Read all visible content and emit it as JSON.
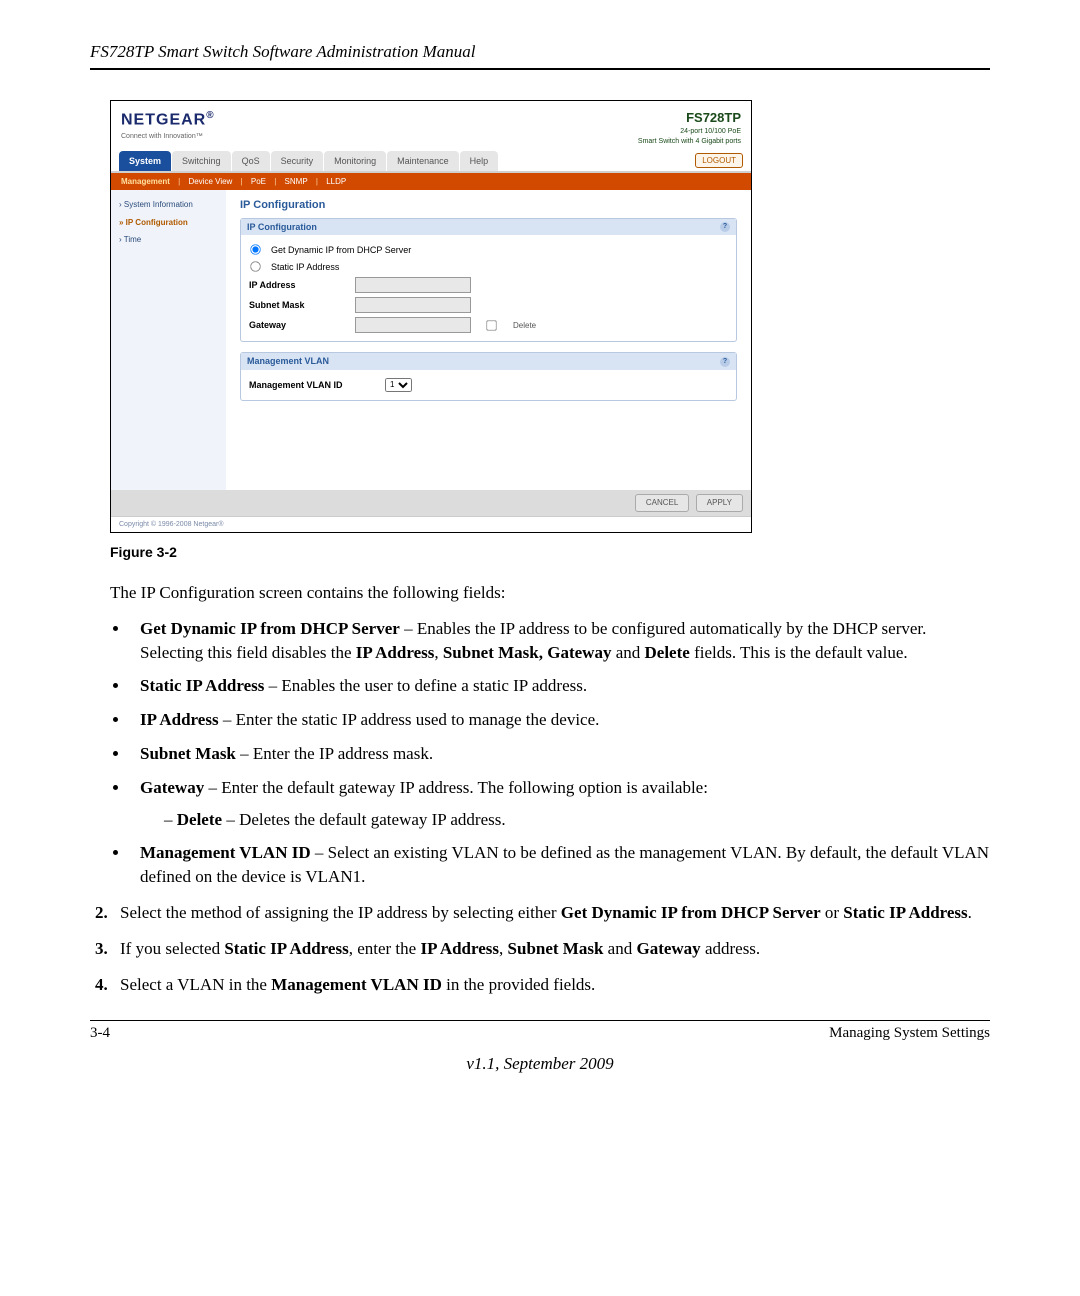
{
  "doc_header": "FS728TP Smart Switch Software Administration Manual",
  "screenshot": {
    "brand": "NETGEAR",
    "tagline": "Connect with Innovation™",
    "product": {
      "model": "FS728TP",
      "desc1": "24-port 10/100 PoE",
      "desc2": "Smart Switch with 4 Gigabit ports"
    },
    "tabs": {
      "system": "System",
      "switching": "Switching",
      "qos": "QoS",
      "security": "Security",
      "monitoring": "Monitoring",
      "maintenance": "Maintenance",
      "help": "Help"
    },
    "logout": "LOGOUT",
    "subnav": {
      "management": "Management",
      "device_view": "Device View",
      "poe": "PoE",
      "snmp": "SNMP",
      "lldp": "LLDP"
    },
    "sidebar": {
      "sys_info": "System Information",
      "ip_config": "IP Configuration",
      "time": "Time"
    },
    "panel": {
      "title": "IP Configuration",
      "section1_title": "IP Configuration",
      "radio_dhcp": "Get Dynamic IP from DHCP Server",
      "radio_static": "Static IP Address",
      "ip_address_lbl": "IP Address",
      "subnet_lbl": "Subnet Mask",
      "gateway_lbl": "Gateway",
      "delete_lbl": "Delete",
      "section2_title": "Management VLAN",
      "mgmt_vlan_lbl": "Management VLAN ID",
      "mgmt_vlan_value": "1"
    },
    "footer": {
      "cancel": "CANCEL",
      "apply": "APPLY"
    },
    "copyright": "Copyright © 1996-2008 Netgear®"
  },
  "figure_caption": "Figure 3-2",
  "intro": "The IP Configuration screen contains the following fields:",
  "bullets": {
    "b1_title": "Get Dynamic IP from DHCP Server",
    "b1_rest": " – Enables the IP address to be configured automatically by the DHCP server. Selecting this field disables the ",
    "b1_bold2": "IP Address",
    "b1_sep1": ", ",
    "b1_bold3": "Subnet Mask, Gateway",
    "b1_sep2": " and ",
    "b1_bold4": "Delete",
    "b1_end": " fields. This is the default value.",
    "b2_title": "Static IP Address",
    "b2_rest": " – Enables the user to define a static IP address.",
    "b3_title": "IP Address",
    "b3_rest": " – Enter the static IP address used to manage the device.",
    "b4_title": "Subnet Mask",
    "b4_rest": " – Enter the IP address mask.",
    "b5_title": "Gateway",
    "b5_rest": " – Enter the default gateway IP address. The following option is available:",
    "b5_sub_title": "Delete",
    "b5_sub_rest": " – Deletes the default gateway IP address.",
    "b6_title": "Management VLAN ID",
    "b6_rest": " – Select an existing VLAN to be defined as the management VLAN. By default, the default VLAN defined on the device is VLAN1."
  },
  "steps": {
    "s2_a": "Select the method of assigning the IP address by selecting either ",
    "s2_b1": "Get Dynamic IP from DHCP Server",
    "s2_mid": " or ",
    "s2_b2": "Static IP Address",
    "s2_end": ".",
    "s3_a": "If you selected ",
    "s3_b1": "Static IP Address",
    "s3_mid1": ", enter the ",
    "s3_b2": "IP Address",
    "s3_mid2": ", ",
    "s3_b3": "Subnet Mask",
    "s3_mid3": " and ",
    "s3_b4": "Gateway",
    "s3_end": " address.",
    "s4_a": "Select a VLAN in the ",
    "s4_b1": "Management VLAN ID",
    "s4_end": " in the provided fields."
  },
  "page_footer": {
    "left": "3-4",
    "right": "Managing System Settings",
    "version": "v1.1, September 2009"
  }
}
